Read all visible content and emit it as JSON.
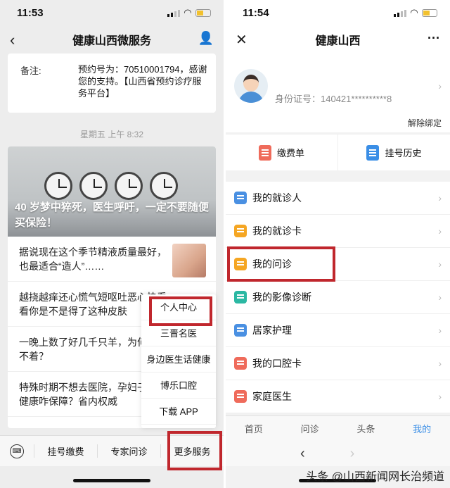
{
  "left_phone": {
    "status_time": "11:53",
    "nav_title": "健康山西微服务",
    "message": {
      "key": "备注:",
      "value": "预约号为：70510001794，感谢您的支持。【山西省预约诊疗服务平台】"
    },
    "timestamp": "星期五 上午 8:32",
    "hero_title": "40 岁梦中猝死，医生呼吁，一定不要随便买保险！",
    "articles": [
      "据说现在这个季节精液质量最好，也最适合“造人”……",
      "越挠越痒还心慌气短呕吐恶心快看看你是不是得了这种皮肤",
      "一晚上数了好几千只羊，为何是睡不着？",
      "特殊时期不想去医院，孕妇子身心健康咋保障？省内权威"
    ],
    "popup_menu": [
      "个人中心",
      "三晋名医",
      "身边医生话健康",
      "博乐口腔",
      "下载 APP"
    ],
    "bottom_menu": [
      "挂号缴费",
      "专家问诊",
      "更多服务"
    ]
  },
  "right_phone": {
    "status_time": "11:54",
    "nav_title": "健康山西",
    "id_label": "身份证号：140421**********8",
    "unbind": "解除绑定",
    "quick_actions": [
      "缴费单",
      "挂号历史"
    ],
    "menu_items": [
      {
        "label": "我的就诊人",
        "icon": "patient-icon",
        "color": "#4a90e2"
      },
      {
        "label": "我的就诊卡",
        "icon": "card-icon",
        "color": "#f5a623"
      },
      {
        "label": "我的问诊",
        "icon": "consult-icon",
        "color": "#f5a623"
      },
      {
        "label": "我的影像诊断",
        "icon": "image-diagnosis-icon",
        "color": "#2bb8a3"
      },
      {
        "label": "居家护理",
        "icon": "home-care-icon",
        "color": "#4a90e2"
      },
      {
        "label": "我的口腔卡",
        "icon": "dental-card-icon",
        "color": "#ef6b5b"
      },
      {
        "label": "家庭医生",
        "icon": "family-doctor-icon",
        "color": "#ef6b5b"
      }
    ],
    "tabs": [
      "首页",
      "问诊",
      "头条",
      "我的"
    ],
    "active_tab": "我的"
  },
  "watermark": "头条 @山西新闻网长治频道",
  "highlight_color": "#c0272d"
}
